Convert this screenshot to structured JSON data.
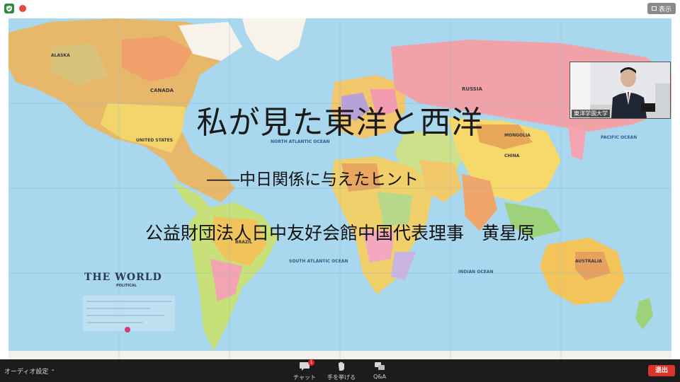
{
  "top_bar": {
    "view_label": "表示"
  },
  "slide": {
    "title": "私が見た東洋と西洋",
    "subtitle": "――中日関係に与えたヒント",
    "author": "公益財団法人日中友好会館中国代表理事　黄星原"
  },
  "map": {
    "legend_title": "THE WORLD",
    "legend_sub": "POLITICAL",
    "labels": [
      "CANADA",
      "RUSSIA",
      "CHINA",
      "UNITED STATES",
      "MONGOLIA",
      "PACIFIC OCEAN",
      "SOUTH ATLANTIC OCEAN",
      "INDIAN OCEAN",
      "NORTH ATLANTIC OCEAN",
      "BRAZIL",
      "AUSTRALIA",
      "ALASKA"
    ]
  },
  "video": {
    "participant_name": "東洋学園大学"
  },
  "bottom_bar": {
    "audio_settings": "オーディオ設定",
    "chat_label": "チャット",
    "chat_badge": "1",
    "raise_hand_label": "手を挙げる",
    "qa_label": "Q&A",
    "leave_label": "退出"
  },
  "colors": {
    "ocean": "#a9d7ee",
    "bottom_bar": "#1c1c1c",
    "leave_button": "#d9352b"
  }
}
